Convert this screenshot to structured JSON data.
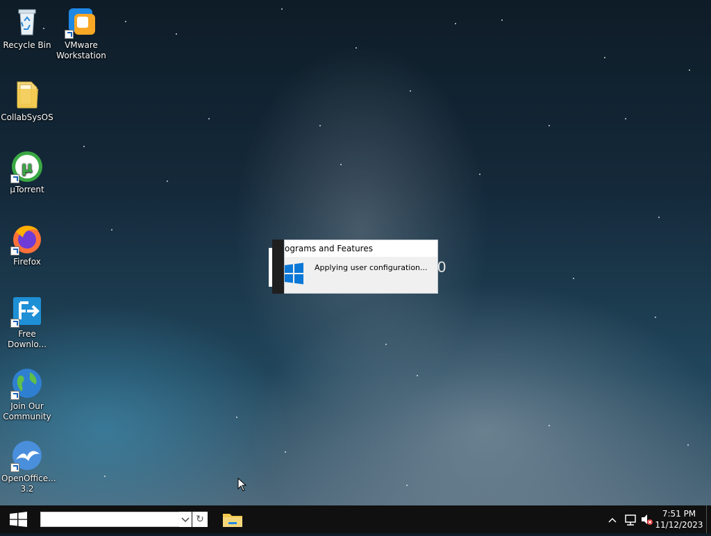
{
  "desktop": {
    "icons": [
      {
        "label": "Recycle Bin",
        "icon": "recycle-bin-icon"
      },
      {
        "label": "VMware Workstation",
        "icon": "vmware-icon"
      },
      {
        "label": "CollabSysOS",
        "icon": "folder-icon"
      },
      {
        "label": "µTorrent",
        "icon": "utorrent-icon"
      },
      {
        "label": "Firefox",
        "icon": "firefox-icon"
      },
      {
        "label": "Free Downlo...",
        "icon": "free-download-manager-icon"
      },
      {
        "label": "Join Our Community",
        "icon": "globe-icon"
      },
      {
        "label": "OpenOffice... 3.2",
        "icon": "openoffice-icon"
      }
    ]
  },
  "dialog": {
    "title": "ograms and Features",
    "message": "Applying user configuration...",
    "ghost_text": "0"
  },
  "taskbar": {
    "search_value": "",
    "refresh_symbol": "↻",
    "clock_time": "7:51 PM",
    "clock_date": "11/12/2023"
  },
  "colors": {
    "taskbar": "#101010",
    "windows_blue": "#0a78d7",
    "dialog_bg": "#f0f0f0"
  }
}
